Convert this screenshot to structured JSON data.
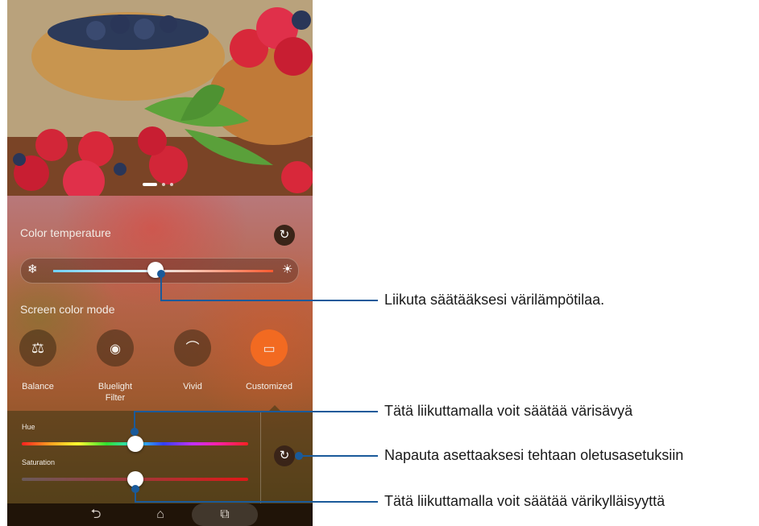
{
  "color_temperature": {
    "title": "Color temperature",
    "reset_icon": "refresh-icon",
    "cool_icon": "snowflake-icon",
    "warm_icon": "sun-icon",
    "level": 0.47
  },
  "screen_color_mode": {
    "title": "Screen color mode",
    "modes": [
      {
        "label": "Balance",
        "icon": "scale-icon"
      },
      {
        "label": "Bluelight",
        "label2": "Filter",
        "icon": "eye-shield-icon"
      },
      {
        "label": "Vivid",
        "icon": "rainbow-icon"
      },
      {
        "label": "Customized",
        "icon": "custom-screen-icon"
      }
    ],
    "selected": "Customized"
  },
  "customize": {
    "hue_label": "Hue",
    "saturation_label": "Saturation",
    "hue_level": 0.5,
    "saturation_level": 0.5,
    "reset_icon": "refresh-icon"
  },
  "navbar": {
    "back_icon": "back-icon",
    "home_icon": "home-icon",
    "recents_icon": "recents-icon"
  },
  "photo": {
    "pager_active": 0,
    "pager_count": 3
  },
  "callouts": {
    "temperature": "Liikuta säätääksesi värilämpötilaa.",
    "hue": "Tätä liikuttamalla voit säätää värisävyä",
    "reset": "Napauta asettaaksesi tehtaan oletusasetuksiin",
    "saturation": "Tätä liikuttamalla voit säätää värikylläisyyttä"
  },
  "colors": {
    "accent": "#f26a21",
    "leader": "#1a5a9a"
  }
}
